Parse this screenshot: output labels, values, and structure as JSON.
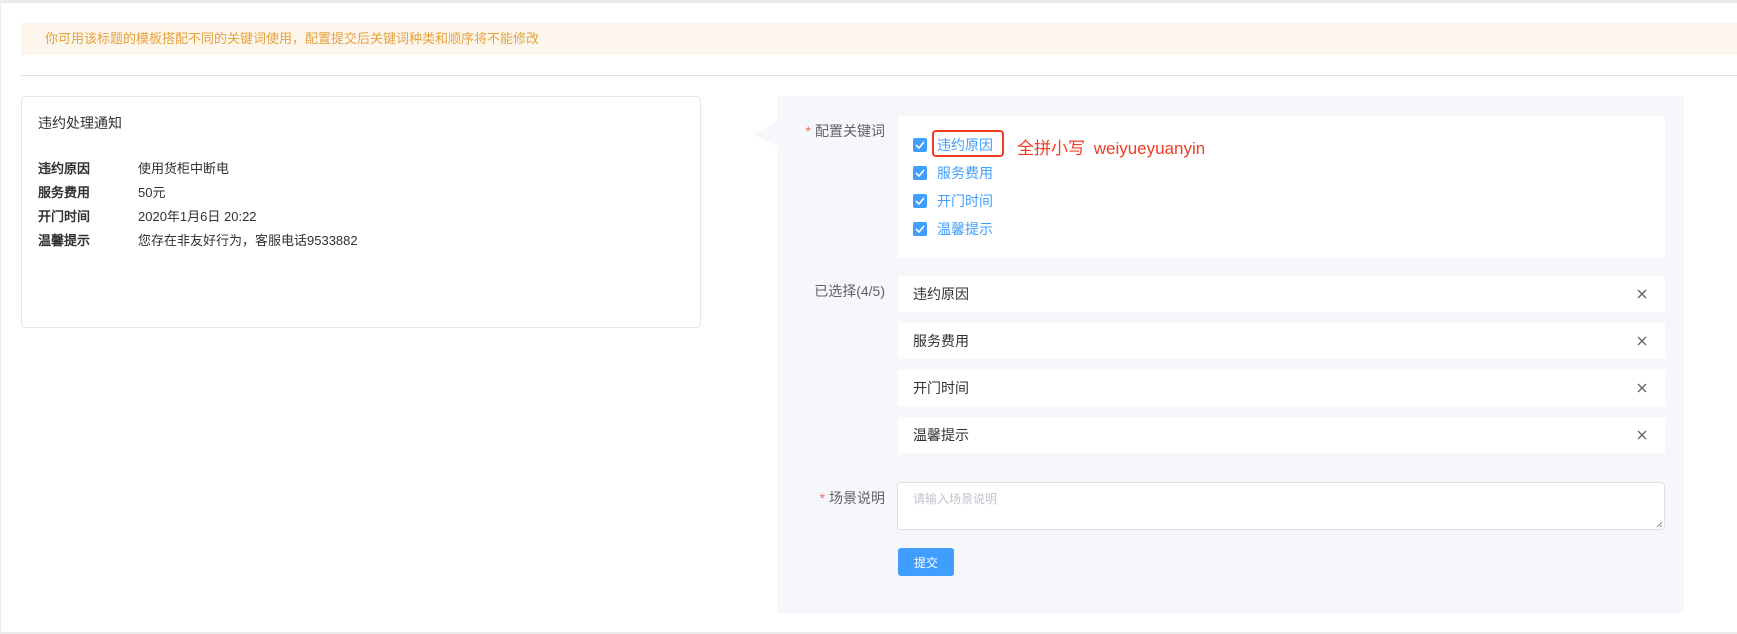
{
  "notice": {
    "text": "你可用该标题的模板搭配不同的关键词使用，配置提交后关键词种类和顺序将不能修改"
  },
  "preview": {
    "title": "违约处理通知",
    "rows": [
      {
        "key": "违约原因",
        "value": "使用货柜中断电"
      },
      {
        "key": "服务费用",
        "value": "50元"
      },
      {
        "key": "开门时间",
        "value": "2020年1月6日 20:22"
      },
      {
        "key": "温馨提示",
        "value": "您存在非友好行为，客服电话9533882"
      }
    ]
  },
  "config": {
    "required_mark": "*",
    "keywords_label": "配置关键词",
    "keywords": [
      {
        "label": "违约原因",
        "checked": true
      },
      {
        "label": "服务费用",
        "checked": true
      },
      {
        "label": "开门时间",
        "checked": true
      },
      {
        "label": "温馨提示",
        "checked": true
      }
    ],
    "annotation": "全拼小写 weiyueyuanyin",
    "selected_label": "已选择(4/5)",
    "selected": [
      "违约原因",
      "服务费用",
      "开门时间",
      "温馨提示"
    ],
    "scene_label": "场景说明",
    "scene_placeholder": "请输入场景说明",
    "scene_value": "",
    "submit_label": "提交"
  },
  "colors": {
    "primary": "#409eff",
    "warning_text": "#e6a23c",
    "warning_bg": "#fdf6ec",
    "danger": "#f56c6c",
    "annotation": "#f03d24"
  },
  "icons": {
    "check": "check-icon",
    "close": "close-icon",
    "resize": "resize-handle-icon"
  }
}
